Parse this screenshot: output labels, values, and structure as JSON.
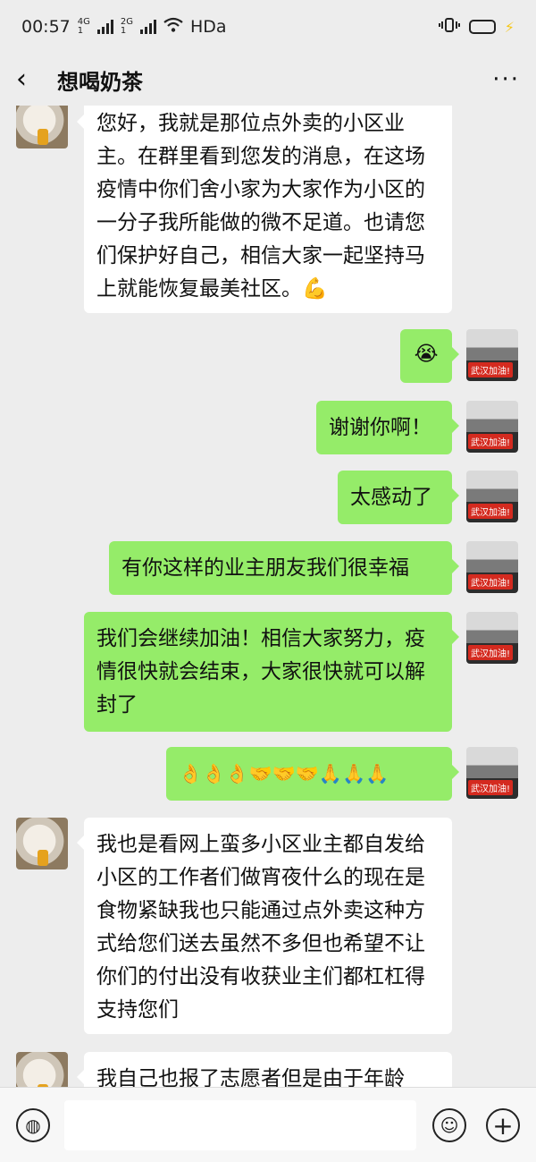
{
  "status_bar": {
    "time": "00:57",
    "net1_top": "4G",
    "net1_bottom": "1",
    "net2_top": "2G",
    "net2_bottom": "1",
    "wifi_label": "HDa",
    "vibrate_icon": "vibrate-icon",
    "battery_color": "#f6c71a"
  },
  "header": {
    "back_icon": "‹",
    "title": "想喝奶茶",
    "more_icon": "···"
  },
  "avatars": {
    "mine_badge": "武汉加油!"
  },
  "messages": [
    {
      "side": "in",
      "text": "您好，我就是那位点外卖的小区业主。在群里看到您发的消息，在这场疫情中你们舍小家为大家作为小区的一分子我所能做的微不足道。也请您们保护好自己，相信大家一起坚持马上就能恢复最美社区。💪"
    },
    {
      "side": "out",
      "text": "😭"
    },
    {
      "side": "out",
      "text": "谢谢你啊！"
    },
    {
      "side": "out",
      "text": "太感动了"
    },
    {
      "side": "out",
      "text": "有你这样的业主朋友我们很幸福"
    },
    {
      "side": "out",
      "text": "我们会继续加油！相信大家努力，疫情很快就会结束，大家很快就可以解封了"
    },
    {
      "side": "out",
      "text": "👌👌👌🤝🤝🤝🙏🙏🙏"
    },
    {
      "side": "in",
      "text": "我也是看网上蛮多小区业主都自发给小区的工作者们做宵夜什么的现在是食物紧缺我也只能通过点外卖这种方式给您们送去虽然不多但也希望不让你们的付出没有收获业主们都杠杠得支持您们"
    },
    {
      "side": "in",
      "text": "我自己也报了志愿者但是由于年龄"
    }
  ],
  "input_bar": {
    "voice_icon": "voice-icon",
    "emoji_icon": "emoji-icon",
    "plus_icon": "plus-icon",
    "voice_glyph": "◍",
    "emoji_glyph": "☺",
    "plus_glyph": "+"
  }
}
